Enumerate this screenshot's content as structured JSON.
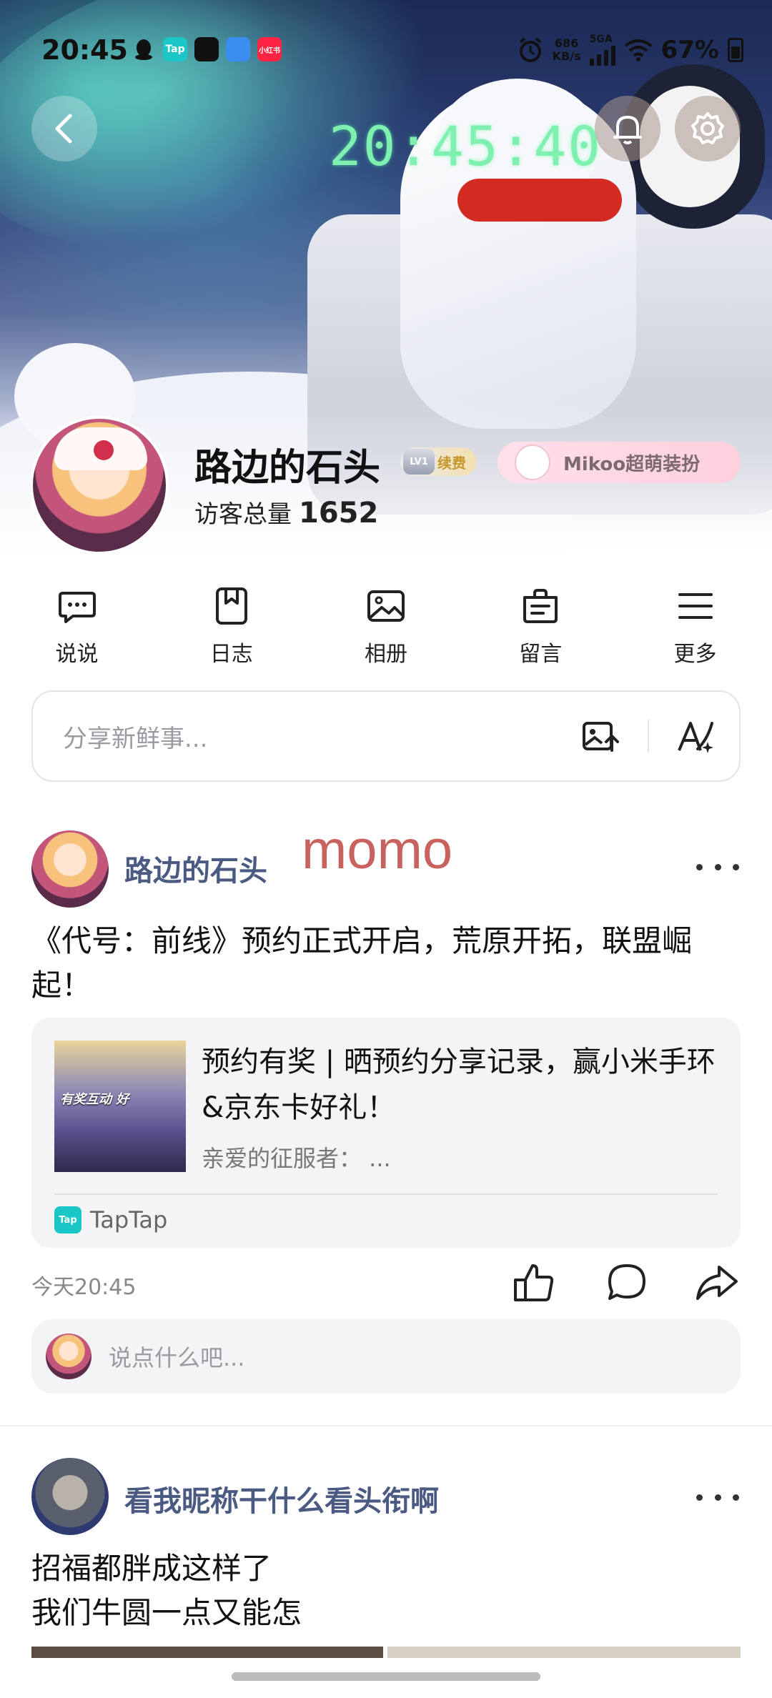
{
  "status_bar": {
    "time": "20:45",
    "app_icons": [
      "qq-icon",
      "taptap-icon",
      "store-icon",
      "weather-icon",
      "xiaohongshu-icon"
    ],
    "app_icon_labels": [
      "",
      "Tap",
      "",
      "",
      "小红书"
    ],
    "net_speed_value": "686",
    "net_speed_unit": "KB/s",
    "network": "5GA",
    "battery": "67%"
  },
  "banner": {
    "clock": "20:45:40"
  },
  "profile": {
    "name": "路边的石头",
    "level": "LV1",
    "renew_label": "续费",
    "mikoo_label": "Mikoo超萌装扮",
    "visits_label": "访客总量",
    "visits_count": "1652"
  },
  "nav": {
    "items": [
      {
        "label": "说说",
        "icon": "chat-bubble-icon"
      },
      {
        "label": "日志",
        "icon": "bookmark-icon"
      },
      {
        "label": "相册",
        "icon": "image-icon"
      },
      {
        "label": "留言",
        "icon": "message-icon"
      },
      {
        "label": "更多",
        "icon": "menu-icon"
      }
    ]
  },
  "share": {
    "placeholder": "分享新鲜事..."
  },
  "post1": {
    "author": "路边的石头",
    "overlay_text": "momo",
    "text": "《代号：前线》预约正式开启，荒原开拓，联盟崛起！",
    "card": {
      "thumb_caption": "有奖互动 好",
      "title": "预约有奖 | 晒预约分享记录，赢小米手环&京东卡好礼！",
      "desc": "亲爱的征服者：  ...",
      "source": "TapTap",
      "source_logo": "Tap"
    },
    "time": "今天20:45",
    "comment_placeholder": "说点什么吧..."
  },
  "post2": {
    "author": "看我昵称干什么看头衔啊",
    "text_line1": "招福都胖成这样了",
    "text_line2": "我们牛圆一点又能怎"
  }
}
